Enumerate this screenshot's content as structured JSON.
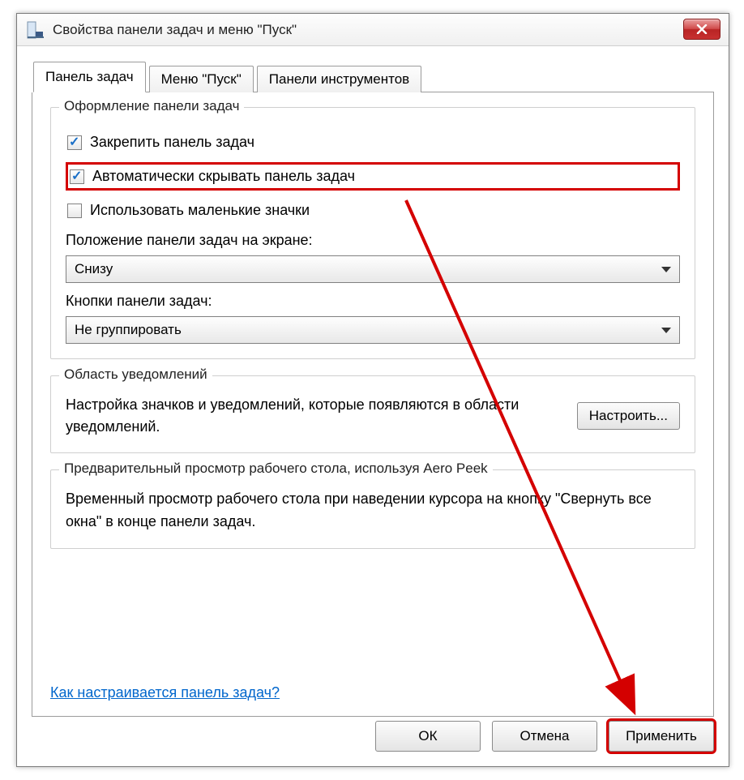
{
  "window": {
    "title": "Свойства панели задач и меню \"Пуск\""
  },
  "tabs": [
    {
      "label": "Панель задач"
    },
    {
      "label": "Меню \"Пуск\""
    },
    {
      "label": "Панели инструментов"
    }
  ],
  "group_appearance": {
    "legend": "Оформление панели задач",
    "check_lock": "Закрепить панель задач",
    "check_autohide": "Автоматически скрывать панель задач",
    "check_smallicons": "Использовать маленькие значки",
    "label_position": "Положение панели задач на экране:",
    "combo_position_value": "Снизу",
    "label_buttons": "Кнопки панели задач:",
    "combo_buttons_value": "Не группировать"
  },
  "group_notif": {
    "legend": "Область уведомлений",
    "text": "Настройка значков и уведомлений, которые появляются в области уведомлений.",
    "button": "Настроить..."
  },
  "group_preview": {
    "legend": "Предварительный просмотр рабочего стола, используя Aero Peek",
    "text": "Временный просмотр рабочего стола при наведении курсора на кнопку \"Свернуть все окна\" в конце панели задач."
  },
  "help_link": "Как настраивается панель задач?",
  "buttons": {
    "ok": "ОК",
    "cancel": "Отмена",
    "apply": "Применить"
  }
}
